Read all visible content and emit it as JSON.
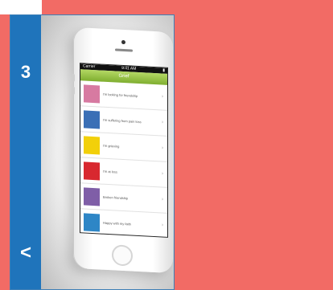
{
  "step": {
    "number": "3",
    "back_label": "<"
  },
  "phone": {
    "status_left": "Carrier",
    "status_center": "9:41 AM",
    "app_title": "Grief",
    "items": [
      {
        "label": "I'm looking for friendship",
        "thumb_color": "#d77aa1",
        "icon": "hand-icon"
      },
      {
        "label": "I'm suffering from pain loss",
        "thumb_color": "#3a6fb6",
        "icon": "wheelchair-icon"
      },
      {
        "label": "I'm grieving",
        "thumb_color": "#f2d00a",
        "icon": "heart-icon"
      },
      {
        "label": "I'm at loss",
        "thumb_color": "#d8282f",
        "icon": "head-icon"
      },
      {
        "label": "Broken friendship",
        "thumb_color": "#7f5ea7",
        "icon": "people-icon"
      },
      {
        "label": "Happy with my faith",
        "thumb_color": "#2e86c6",
        "icon": "cross-icon"
      }
    ]
  },
  "colors": {
    "background": "#f26b65",
    "sidebar": "#1f74bb",
    "appbar": "#7fae30"
  }
}
